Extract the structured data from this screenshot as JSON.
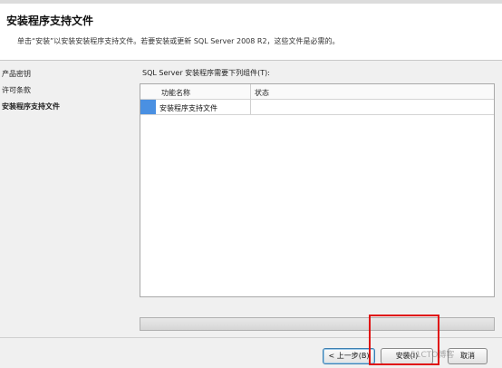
{
  "header": {
    "title": "安装程序支持文件",
    "description": "单击“安装”以安装安装程序支持文件。若要安装或更新 SQL Server 2008 R2，这些文件是必需的。"
  },
  "sidebar": {
    "items": [
      {
        "label": "产品密钥"
      },
      {
        "label": "许可条款"
      },
      {
        "label": "安装程序支持文件"
      }
    ]
  },
  "main": {
    "label": "SQL Server 安装程序需要下列组件(T):",
    "columns": [
      "功能名称",
      "状态"
    ],
    "rows": [
      {
        "feature": "安装程序支持文件",
        "status": ""
      }
    ]
  },
  "progress": {
    "value": 0
  },
  "buttons": {
    "back": "< 上一步(B)",
    "install": "安装(I)",
    "cancel": "取消"
  },
  "watermark": "@51CTO博客",
  "colors": {
    "selection": "#4a90e2",
    "highlight_box": "#e01010"
  }
}
